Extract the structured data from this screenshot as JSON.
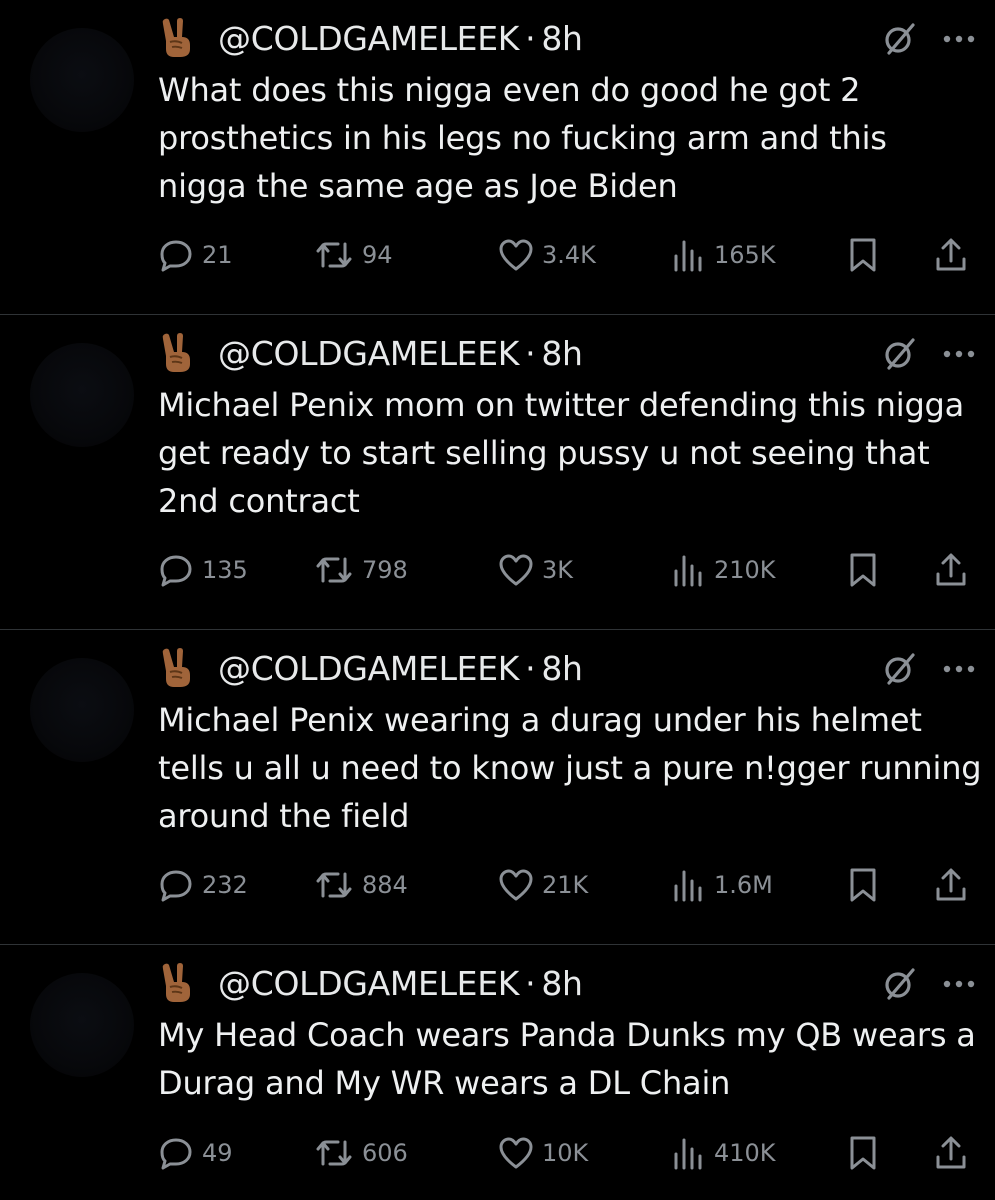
{
  "tweets": [
    {
      "handle": "@COLDGAMELEEK",
      "time": "8h",
      "text": "What does this nigga even do good he got 2 prosthetics in his legs no fucking arm and this nigga the same age as Joe Biden",
      "replies": "21",
      "reposts": "94",
      "likes": "3.4K",
      "views": "165K"
    },
    {
      "handle": "@COLDGAMELEEK",
      "time": "8h",
      "text": "Michael Penix mom on twitter defending this nigga get ready to start selling pussy u not seeing that 2nd contract",
      "replies": "135",
      "reposts": "798",
      "likes": "3K",
      "views": "210K"
    },
    {
      "handle": "@COLDGAMELEEK",
      "time": "8h",
      "text": "Michael Penix wearing a durag under his helmet tells u all u need to know just a pure n!gger running around the field",
      "replies": "232",
      "reposts": "884",
      "likes": "21K",
      "views": "1.6M"
    },
    {
      "handle": "@COLDGAMELEEK",
      "time": "8h",
      "text": "My Head Coach wears Panda Dunks my QB wears a Durag and My WR wears a DL Chain",
      "replies": "49",
      "reposts": "606",
      "likes": "10K",
      "views": "410K"
    }
  ],
  "separator": "·",
  "icons": {
    "name_emoji": "victory-hand-emoji",
    "grok": "grok-icon",
    "more": "more-icon",
    "reply": "reply-icon",
    "repost": "repost-icon",
    "like": "heart-icon",
    "views": "views-icon",
    "bookmark": "bookmark-icon",
    "share": "share-icon"
  },
  "colors": {
    "background": "#000000",
    "text": "#e7e9ea",
    "secondary": "#8b9096",
    "divider": "#2f3336",
    "emoji_skin": "#a0643a"
  }
}
